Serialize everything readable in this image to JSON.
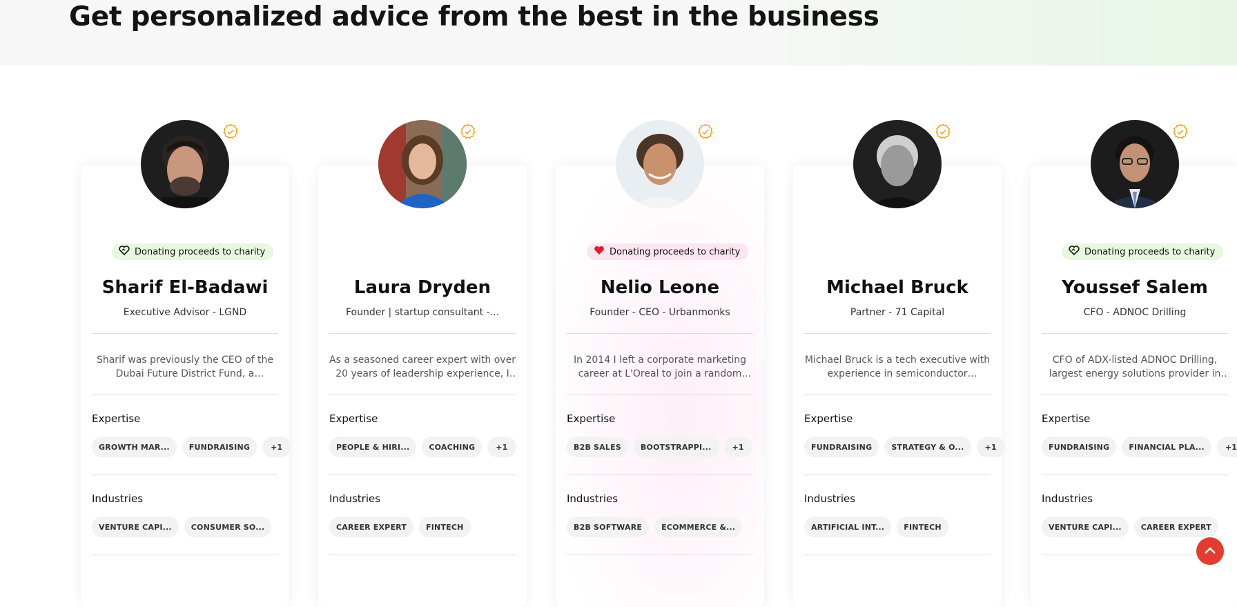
{
  "page": {
    "heading": "Get personalized advice from the best in the business"
  },
  "colors": {
    "charity_pill_green": "#e8f7df",
    "charity_pill_pink": "#fbe6ef",
    "verified_badge": "#f2a516",
    "scroll_button": "#e43d30"
  },
  "experts": [
    {
      "name": "Sharif El-Badawi",
      "role": "Executive Advisor - LGND",
      "bio": "Sharif was previously the CEO of the Dubai Future District Fund, a venture...",
      "charity": "Donating proceeds to charity",
      "charity_icon": "heart-outline-icon",
      "expertise_label": "Expertise",
      "expertise": [
        "GROWTH MAR...",
        "FUNDRAISING",
        "+1"
      ],
      "industries_label": "Industries",
      "industries": [
        "VENTURE CAPI...",
        "CONSUMER SO..."
      ]
    },
    {
      "name": "Laura Dryden",
      "role": "Founder | startup consultant -...",
      "bio": "As a seasoned career expert with over 20 years of leadership experience, I have a...",
      "charity": "",
      "expertise_label": "Expertise",
      "expertise": [
        "PEOPLE & HIRI...",
        "COACHING",
        "+1"
      ],
      "industries_label": "Industries",
      "industries": [
        "CAREER EXPERT",
        "FINTECH"
      ]
    },
    {
      "name": "Nelio Leone",
      "role": "Founder - CEO - Urbanmonks",
      "bio": "In 2014 I left a corporate marketing career at L'Oreal to join a random startu...",
      "charity": "Donating proceeds to charity",
      "charity_icon": "heart-filled-icon",
      "expertise_label": "Expertise",
      "expertise": [
        "B2B SALES",
        "BOOTSTRAPPI...",
        "+1"
      ],
      "industries_label": "Industries",
      "industries": [
        "B2B SOFTWARE",
        "ECOMMERCE &..."
      ]
    },
    {
      "name": "Michael Bruck",
      "role": "Partner - 71 Capital",
      "bio": "Michael Bruck is a tech executive with experience in semiconductor design,...",
      "charity": "",
      "expertise_label": "Expertise",
      "expertise": [
        "FUNDRAISING",
        "STRATEGY & O...",
        "+1"
      ],
      "industries_label": "Industries",
      "industries": [
        "ARTIFICIAL INT...",
        "FINTECH"
      ]
    },
    {
      "name": "Youssef Salem",
      "role": "CFO - ADNOC Drilling",
      "bio": "CFO of ADX-listed ADNOC Drilling, largest energy solutions provider in EMEA...",
      "charity": "Donating proceeds to charity",
      "charity_icon": "heart-outline-icon",
      "expertise_label": "Expertise",
      "expertise": [
        "FUNDRAISING",
        "FINANCIAL PLA...",
        "+1"
      ],
      "industries_label": "Industries",
      "industries": [
        "VENTURE CAPI...",
        "CAREER EXPERT"
      ]
    }
  ]
}
